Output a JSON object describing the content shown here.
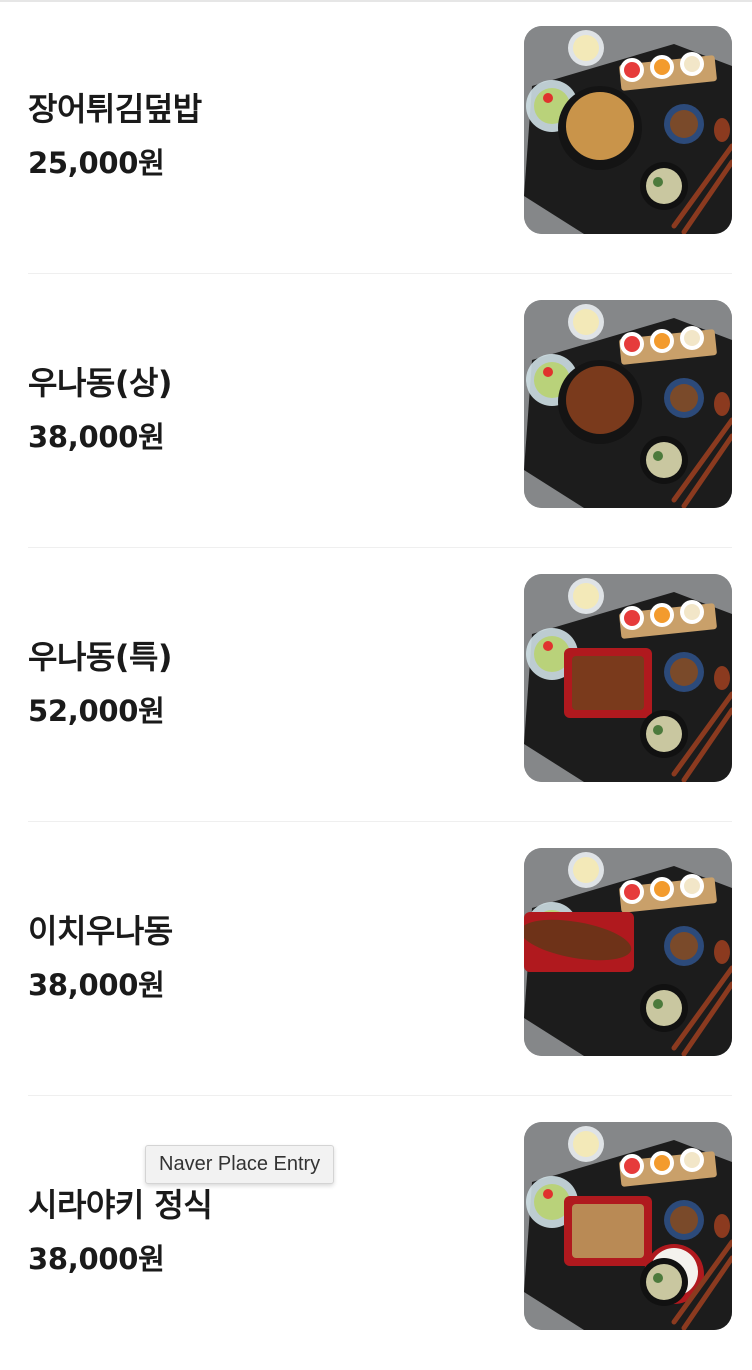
{
  "menu": {
    "items": [
      {
        "name": "장어튀김덮밥",
        "price": "25,000원",
        "photo": "tempura-rice-bowl-set-photo",
        "main_color": "#c9944a"
      },
      {
        "name": "우나동(상)",
        "price": "38,000원",
        "photo": "eel-rice-bowl-premium-set-photo",
        "main_color": "#7a3a1c"
      },
      {
        "name": "우나동(특)",
        "price": "52,000원",
        "photo": "eel-rice-box-special-set-photo",
        "main_color": "#7a3a1c"
      },
      {
        "name": "이치우나동",
        "price": "38,000원",
        "photo": "whole-eel-rice-set-photo",
        "main_color": "#6e3218"
      },
      {
        "name": "시라야키 정식",
        "price": "38,000원",
        "photo": "shirayaki-set-meal-photo",
        "main_color": "#b98a55"
      }
    ]
  },
  "tooltip": {
    "text": "Naver Place Entry"
  },
  "colors": {
    "text": "#1a1a1a",
    "divider": "#efefef",
    "photo_background": "#8a8c8e",
    "tray": "#1c1c1c",
    "chopsticks": "#8b3a1f"
  }
}
